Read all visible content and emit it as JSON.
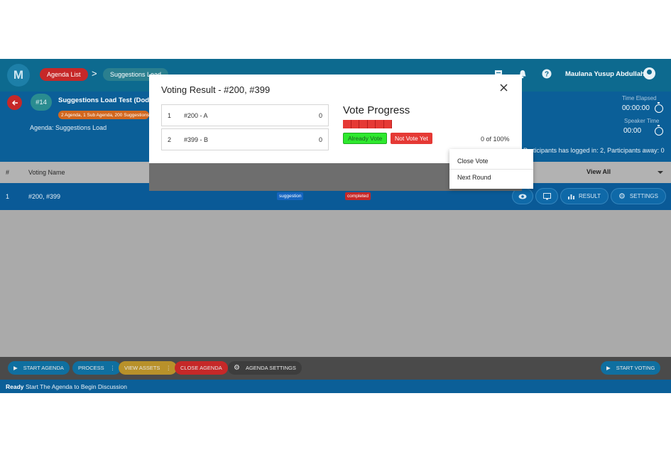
{
  "nav": {
    "logo_letter": "M",
    "breadcrumb": [
      "Agenda List",
      "Suggestions Load"
    ],
    "breadcrumb_sep": ">",
    "user_name": "Maulana Yusup Abdullah"
  },
  "header": {
    "meeting_number": "#14",
    "meeting_title": "Suggestions Load Test (Dodo)",
    "meeting_badge": "2 Agenda, 1 Sub Agenda, 200 Suggestions",
    "agenda_label": "Agenda: Suggestions Load",
    "time_elapsed_label": "Time Elapsed",
    "time_elapsed_value": "00:00:00",
    "speaker_time_label": "Speaker Time",
    "speaker_time_value": "00:00",
    "participants_text": "Participants has logged in: 2, Participants away: 0"
  },
  "table": {
    "headers": [
      "#",
      "Voting Name"
    ],
    "view_all": "View All",
    "rows": [
      {
        "num": "1",
        "name": "#200, #399",
        "type_tag": "suggestion",
        "status_tag": "completed",
        "result_label": "RESULT",
        "settings_label": "SETTINGS"
      }
    ]
  },
  "modal": {
    "title": "Voting Result - #200, #399",
    "close_icon": "close-icon",
    "results": [
      {
        "num": "1",
        "name": "#200 - A",
        "count": "0"
      },
      {
        "num": "2",
        "name": "#399 - B",
        "count": "0"
      }
    ],
    "progress_title": "Vote Progress",
    "progress_segments": 6,
    "progress_fraction": 0,
    "already_vote": "Already Vote",
    "not_vote_yet": "Not Vote Yet",
    "progress_text": "0 of 100%"
  },
  "menu": {
    "items": [
      "Close Vote",
      "Next Round"
    ]
  },
  "footer": {
    "start_agenda": "START AGENDA",
    "process": "PROCESS",
    "view_assets": "VIEW ASSETS",
    "close_agenda": "CLOSE AGENDA",
    "agenda_settings": "AGENDA SETTINGS",
    "start_voting": "START VOTING"
  },
  "status": {
    "state": "Ready",
    "message": "Start The Agenda to Begin Discussion"
  },
  "colors": {
    "nav_bg": "#0d6a8f",
    "header_bg": "#0b5f98",
    "already_vote": "#2ee82e",
    "not_vote_yet": "#e53935",
    "danger": "#c62828"
  }
}
